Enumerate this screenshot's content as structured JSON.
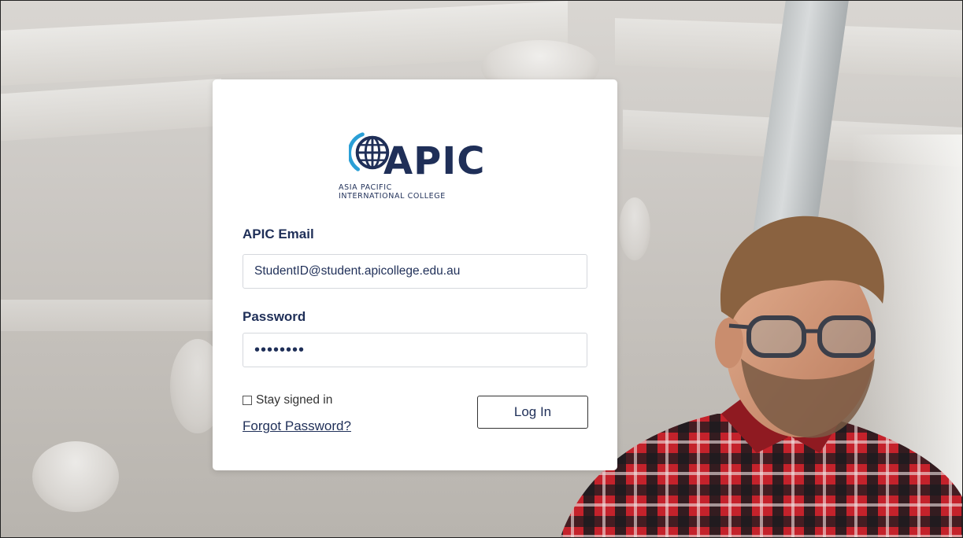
{
  "brand": {
    "name": "APIC",
    "subtitle_line1": "ASIA PACIFIC",
    "subtitle_line2": "INTERNATIONAL COLLEGE",
    "color": "#1f2f58",
    "accent": "#2a9fd6",
    "logo_icon": "globe-icon"
  },
  "form": {
    "email_label": "APIC Email",
    "email_value": "StudentID@student.apicollege.edu.au",
    "password_label": "Password",
    "password_value": "••••••••",
    "remember_label": "Stay signed in",
    "remember_checked": false,
    "forgot_label": "Forgot Password?",
    "submit_label": "Log In"
  }
}
